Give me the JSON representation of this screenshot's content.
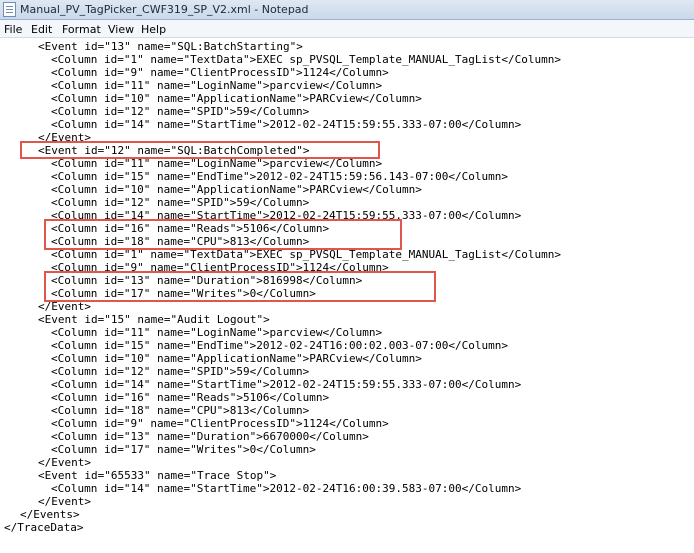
{
  "window": {
    "title": "Manual_PV_TagPicker_CWF319_SP_V2.xml - Notepad"
  },
  "menu": {
    "items": [
      "File",
      "Edit",
      "Format",
      "View",
      "Help"
    ]
  },
  "editor": {
    "lines": [
      "<Event id=\"13\" name=\"SQL:BatchStarting\">",
      "<Column id=\"1\" name=\"TextData\">EXEC sp_PVSQL_Template_MANUAL_TagList</Column>",
      "<Column id=\"9\" name=\"ClientProcessID\">1124</Column>",
      "<Column id=\"11\" name=\"LoginName\">parcview</Column>",
      "<Column id=\"10\" name=\"ApplicationName\">PARCview</Column>",
      "<Column id=\"12\" name=\"SPID\">59</Column>",
      "<Column id=\"14\" name=\"StartTime\">2012-02-24T15:59:55.333-07:00</Column>",
      "</Event>",
      "<Event id=\"12\" name=\"SQL:BatchCompleted\">",
      "<Column id=\"11\" name=\"LoginName\">parcview</Column>",
      "<Column id=\"15\" name=\"EndTime\">2012-02-24T15:59:56.143-07:00</Column>",
      "<Column id=\"10\" name=\"ApplicationName\">PARCview</Column>",
      "<Column id=\"12\" name=\"SPID\">59</Column>",
      "<Column id=\"14\" name=\"StartTime\">2012-02-24T15:59:55.333-07:00</Column>",
      "<Column id=\"16\" name=\"Reads\">5106</Column>",
      "<Column id=\"18\" name=\"CPU\">813</Column>",
      "<Column id=\"1\" name=\"TextData\">EXEC sp_PVSQL_Template_MANUAL_TagList</Column>",
      "<Column id=\"9\" name=\"ClientProcessID\">1124</Column>",
      "<Column id=\"13\" name=\"Duration\">816998</Column>",
      "<Column id=\"17\" name=\"Writes\">0</Column>",
      "</Event>",
      "<Event id=\"15\" name=\"Audit Logout\">",
      "<Column id=\"11\" name=\"LoginName\">parcview</Column>",
      "<Column id=\"15\" name=\"EndTime\">2012-02-24T16:00:02.003-07:00</Column>",
      "<Column id=\"10\" name=\"ApplicationName\">PARCview</Column>",
      "<Column id=\"12\" name=\"SPID\">59</Column>",
      "<Column id=\"14\" name=\"StartTime\">2012-02-24T15:59:55.333-07:00</Column>",
      "<Column id=\"16\" name=\"Reads\">5106</Column>",
      "<Column id=\"18\" name=\"CPU\">813</Column>",
      "<Column id=\"9\" name=\"ClientProcessID\">1124</Column>",
      "<Column id=\"13\" name=\"Duration\">6670000</Column>",
      "<Column id=\"17\" name=\"Writes\">0</Column>",
      "</Event>",
      "<Event id=\"65533\" name=\"Trace Stop\">",
      "<Column id=\"14\" name=\"StartTime\">2012-02-24T16:00:39.583-07:00</Column>",
      "</Event>",
      "</Events>",
      "</TraceData>"
    ]
  },
  "colors": {
    "highlight_box": "#e0554c",
    "titlebar": "#c9d8ea"
  }
}
